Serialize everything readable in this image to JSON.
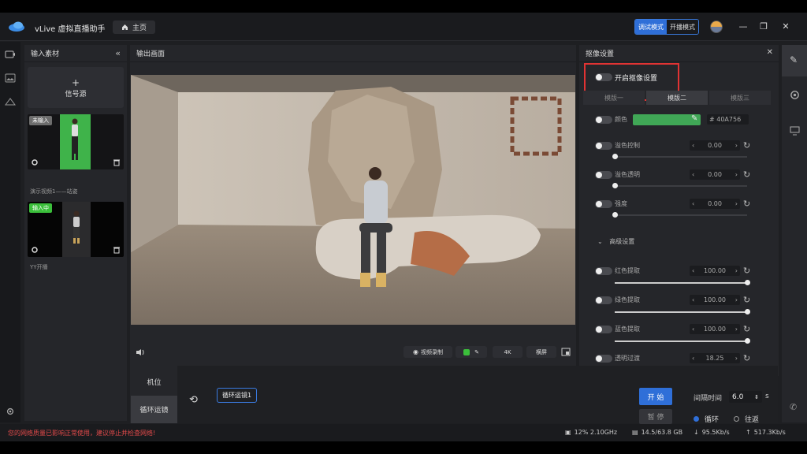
{
  "app": {
    "title": "vLive 虚拟直播助手",
    "home_label": "主页"
  },
  "modes": {
    "debug": "调试模式",
    "live": "开播模式"
  },
  "left_panel": {
    "title": "输入素材",
    "add_source_plus": "+",
    "add_source": "信号源",
    "sources": [
      {
        "badge": "未输入",
        "caption": "演示视频1——站姿"
      },
      {
        "badge": "输入中",
        "caption": "YY开播"
      }
    ]
  },
  "output": {
    "title": "输出画面",
    "record": "视频录制",
    "resolution": "4K",
    "orientation": "横屏"
  },
  "keying": {
    "title": "抠像设置",
    "enable_label": "开启抠像设置",
    "tabs": [
      "模版一",
      "模版二",
      "模版三"
    ],
    "color_label": "颜色",
    "color_value": "# 40A756",
    "color_swatch": "#40A756",
    "rows": [
      {
        "label": "溢色控制",
        "value": "0.00",
        "fraction": 0.0
      },
      {
        "label": "溢色透明",
        "value": "0.00",
        "fraction": 0.0
      },
      {
        "label": "强度",
        "value": "0.00",
        "fraction": 0.0
      }
    ],
    "advanced": "高级设置",
    "adv_rows": [
      {
        "label": "红色提取",
        "value": "100.00",
        "fraction": 1.0
      },
      {
        "label": "绿色提取",
        "value": "100.00",
        "fraction": 1.0
      },
      {
        "label": "蓝色提取",
        "value": "100.00",
        "fraction": 1.0
      },
      {
        "label": "透明过渡",
        "value": "18.25"
      }
    ]
  },
  "camera": {
    "tabs": [
      "机位",
      "循环运镜"
    ],
    "chip": "循环运镜1",
    "start": "开 始",
    "pause": "暂 停",
    "interval_label": "间隔时间",
    "interval_value": "6.0",
    "interval_unit": "s",
    "loop": "循环",
    "pingpong": "往返"
  },
  "status": {
    "warning": "您的网络质量已影响正常使用，建议停止并检查网络!",
    "cpu": "12% 2.10GHz",
    "mem": "14.5/63.8 GB",
    "down": "95.5Kb/s",
    "up": "517.3Kb/s"
  },
  "colors": {
    "accent": "#2f6fd8",
    "warning": "#e04a4a",
    "green_badge": "#3bbf3b"
  }
}
